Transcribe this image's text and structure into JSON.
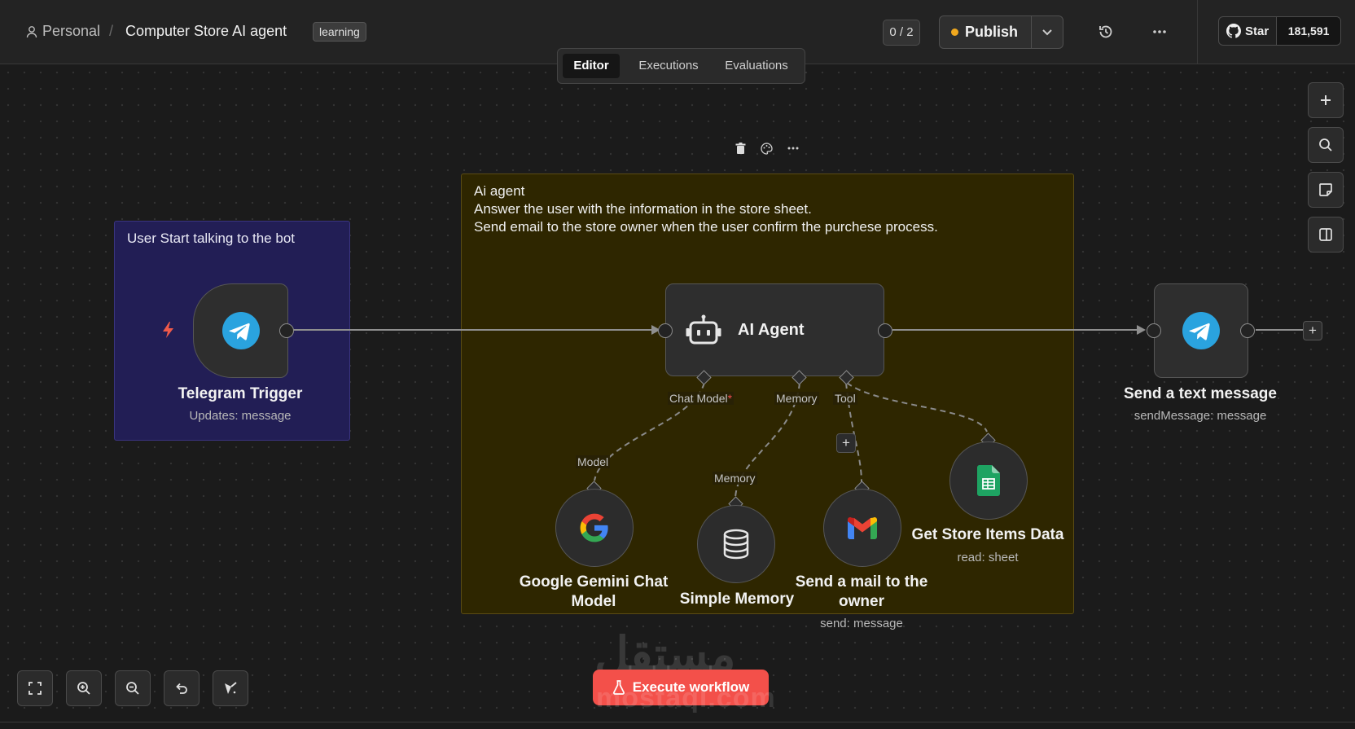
{
  "header": {
    "breadcrumb_user": "Personal",
    "breadcrumb_sep": "/",
    "workflow_title": "Computer Store AI agent",
    "tag": "learning",
    "counter": "0 / 2",
    "publish_label": "Publish",
    "github_star_label": "Star",
    "github_star_count": "181,591"
  },
  "tabs": [
    "Editor",
    "Executions",
    "Evaluations"
  ],
  "stickies": {
    "trigger_note": "User Start talking to the bot",
    "agent_note": [
      "Ai agent",
      "Answer the user with the information in the store sheet.",
      "Send email to the store owner when the user confirm the purchese process."
    ]
  },
  "nodes": {
    "telegram_trigger": {
      "title": "Telegram Trigger",
      "subtitle": "Updates: message",
      "icon": "telegram-icon"
    },
    "ai_agent": {
      "title": "AI Agent",
      "icon": "robot-icon"
    },
    "send_text": {
      "title": "Send a text message",
      "subtitle": "sendMessage: message",
      "icon": "telegram-icon"
    },
    "gemini": {
      "title_line1": "Google Gemini Chat",
      "title_line2": "Model",
      "icon": "google-icon"
    },
    "memory": {
      "title": "Simple Memory",
      "icon": "database-icon"
    },
    "gmail": {
      "title_line1": "Send a mail to the",
      "title_line2": "owner",
      "subtitle": "send: message",
      "icon": "gmail-icon"
    },
    "sheets": {
      "title": "Get Store Items Data",
      "subtitle": "read: sheet",
      "icon": "google-sheets-icon"
    }
  },
  "ports": {
    "chat_model": "Chat Model",
    "required_mark": "*",
    "memory": "Memory",
    "tool": "Tool",
    "model": "Model",
    "memory_input": "Memory"
  },
  "footer": {
    "execute_label": "Execute workflow"
  },
  "watermark": {
    "arabic": "مستقل",
    "latin": "mostaql.com"
  },
  "colors": {
    "accent_execute": "#f3504a",
    "telegram_blue": "#2aa3df",
    "publish_dot": "#f0a81e",
    "trigger_bolt": "#ef5a4a",
    "sticky_purple": "#221e55",
    "sticky_yellow": "#2e2600"
  }
}
